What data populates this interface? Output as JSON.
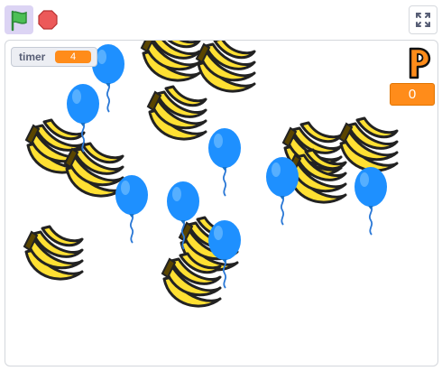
{
  "toolbar": {
    "green_flag_icon": "green-flag-icon",
    "stop_icon": "stop-icon",
    "fullscreen_icon": "fullscreen-icon"
  },
  "stage": {
    "variable_monitor": {
      "label": "timer",
      "value": "4"
    },
    "score": {
      "value": "0"
    },
    "sprites": {
      "banana": "banana-bunch",
      "balloon": "blue-balloon",
      "letter": "letter-p"
    }
  },
  "colors": {
    "monitor_value": "#ff8c1a",
    "flag_button_active": "#dcd4f4",
    "flag_green": "#4cbf56",
    "stop_red": "#ec5959",
    "balloon_blue": "#1e90ff",
    "banana_yellow": "#ffe033"
  }
}
